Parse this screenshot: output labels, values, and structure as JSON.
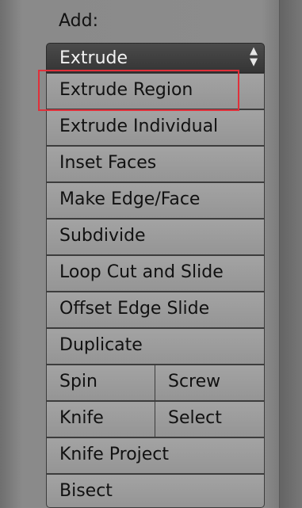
{
  "header": {
    "add_label": "Add:"
  },
  "dropdown": {
    "selected": "Extrude"
  },
  "buttons": {
    "extrude_region": "Extrude Region",
    "extrude_individual": "Extrude Individual",
    "inset_faces": "Inset Faces",
    "make_edge_face": "Make Edge/Face",
    "subdivide": "Subdivide",
    "loop_cut_and_slide": "Loop Cut and Slide",
    "offset_edge_slide": "Offset Edge Slide",
    "duplicate": "Duplicate",
    "spin": "Spin",
    "screw": "Screw",
    "knife": "Knife",
    "select": "Select",
    "knife_project": "Knife Project",
    "bisect": "Bisect"
  },
  "colors": {
    "highlight": "#e0303a",
    "button_bg": "#9c9c9c",
    "dropdown_bg": "#404040",
    "panel_bg": "#8a8a8a"
  }
}
